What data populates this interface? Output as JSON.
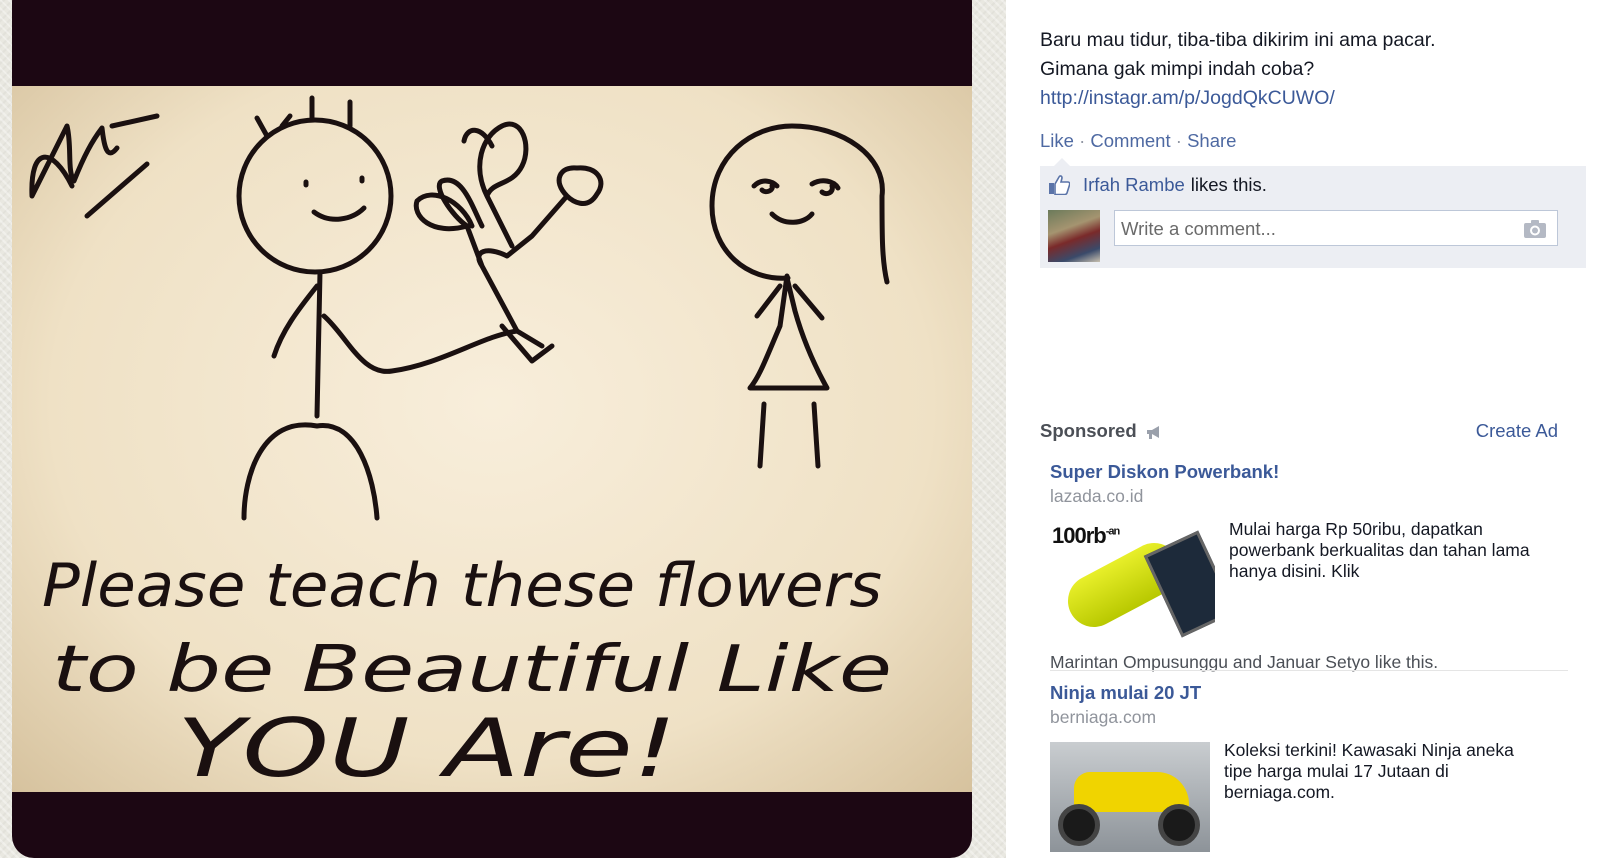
{
  "photo": {
    "drawing_text": [
      "Please teach these flowers",
      "to be Beautiful Like",
      "YOU Are!"
    ],
    "signature": "Anit"
  },
  "post": {
    "caption_line1": "Baru mau tidur, tiba-tiba dikirim ini ama pacar.",
    "caption_line2": "Gimana gak mimpi indah coba?",
    "link": "http://instagr.am/p/JogdQkCUWO/",
    "actions": {
      "like": "Like",
      "comment": "Comment",
      "share": "Share",
      "separator": "·"
    },
    "likes": {
      "name": "Irfah Rambe",
      "suffix": "likes this."
    },
    "comment_placeholder": "Write a comment..."
  },
  "sponsored": {
    "heading": "Sponsored",
    "create_ad": "Create Ad",
    "ads": [
      {
        "title": "Super Diskon Powerbank!",
        "domain": "lazada.co.id",
        "description": "Mulai harga Rp 50ribu, dapatkan powerbank berkualitas dan tahan lama hanya disini. Klik",
        "image_text": "100rb",
        "image_superscript": "-an",
        "social": "Marintan Ompusunggu and Januar Setyo like this."
      },
      {
        "title": "Ninja mulai 20 JT",
        "domain": "berniaga.com",
        "description": "Koleksi terkini! Kawasaki Ninja aneka tipe harga mulai 17 Jutaan di berniaga.com."
      }
    ]
  },
  "colors": {
    "link": "#3b5998",
    "ufi_bg": "#eceef3",
    "photo_frame": "#1c0713"
  },
  "icons": [
    "thumbs-up-icon",
    "camera-icon",
    "megaphone-icon"
  ]
}
